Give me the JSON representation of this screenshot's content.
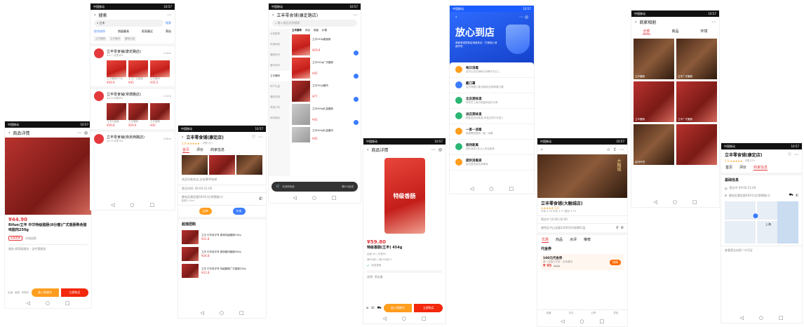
{
  "status": {
    "left": "中国移动",
    "right": "10:57"
  },
  "s1": {
    "title": "商品详情",
    "price": "¥44.90",
    "name": "Rifun/立丰 中华特级腊肠(8分瘦)广式香肠熟食腊味腊肉250g",
    "tag": "免费退换",
    "tag2": "闪电退款",
    "service": "服务 商家配服务 · 全件满意退",
    "btn_cart": "加入购物车",
    "btn_buy": "立即购买",
    "bt1": "店铺",
    "bt2": "客服",
    "bt3": "购物车"
  },
  "s2": {
    "title": "搜索",
    "search": "立丰",
    "search_btn": "搜索",
    "tabs": [
      "综合排序",
      "销量最高",
      "距离最近",
      "筛选"
    ],
    "chips": [
      "立丰腊肠",
      "立丰腊肉",
      "腊味礼盒"
    ],
    "shops": [
      {
        "name": "立丰零食铺(康定路店)",
        "meta": "★4.7 月售999",
        "dist": "1.5km",
        "items": [
          {
            "n": "立丰腊肠250g",
            "p": "¥29.9"
          },
          {
            "n": "立丰广式香肠",
            "p": "¥45"
          },
          {
            "n": "立丰腊肉",
            "p": "¥35.5"
          }
        ]
      },
      {
        "name": "立丰零食铺(常德路店)",
        "meta": "★4.8 月售800",
        "dist": "2.1km",
        "items": [
          {
            "n": "立丰礼盒装",
            "p": "¥59.8"
          },
          {
            "n": "立丰腊肠",
            "p": "¥29.9"
          },
          {
            "n": "立丰香肠",
            "p": "¥45"
          }
        ]
      },
      {
        "name": "立丰零食铺(南京西路店)",
        "meta": "★4.6 月售700",
        "dist": "2.8km",
        "items": []
      }
    ]
  },
  "s3": {
    "title": "立丰零食铺(康定店)",
    "rating": "5.0 ★★★★★",
    "sold": "月售1万+",
    "tabs": [
      "首页",
      "评价",
      "商家信息"
    ],
    "notice": "欢迎光临本店,全场满99包邮",
    "hours": "营业时间: 09:00-21:00",
    "addr": "静安区康定路583号(近常德路口)",
    "addr2": "距离1.5km",
    "btn1": "买单",
    "btn2": "外卖",
    "section": "超值团购",
    "deals": [
      {
        "n": "立丰 中华老字号 原味特级腊肠150g",
        "p": "¥21.8"
      },
      {
        "n": "立丰 中华老字号 原味腊肉腊肠950g",
        "p": "¥26.8"
      },
      {
        "n": "立丰 中华老字号 特级腊肠广式香肠250g",
        "p": "¥31.8"
      }
    ]
  },
  "s4": {
    "title": "立丰零食铺(康定路店)",
    "search_ph": "输入商品名称搜索",
    "cats": [
      "为您推荐",
      "热销商品",
      "腊肠系列",
      "腊肉系列",
      "立丰腊味",
      "特产礼盒",
      "腊味拼盘",
      "零食小吃",
      "休闲食品"
    ],
    "subtabs": [
      "立丰腊味",
      "综合",
      "销量",
      "价格"
    ],
    "items": [
      {
        "n": "立丰250g腊香肠",
        "p": "¥29.9"
      },
      {
        "n": "立丰250g广式腊肠",
        "p": "¥45"
      },
      {
        "n": "立丰250g腊肉",
        "p": "¥77"
      },
      {
        "n": "立丰400g礼盒腊肠",
        "p": "¥45"
      },
      {
        "n": "立丰400g礼盒腊肉",
        "p": "¥45"
      }
    ],
    "cart": "未选购商品",
    "cart_btn": "满¥20起送"
  },
  "s5": {
    "title": "商品详情",
    "price": "¥59.80",
    "name": "特级香肠(立丰) 454g",
    "ship": "运费 ¥0 | 月售99",
    "promo": "满99减5 | 满199减15",
    "tag": "免费退换",
    "spec": "选择: 净含量",
    "btn_cart": "加入购物车",
    "btn_buy": "立即购买",
    "pkg_text": "特级香肠"
  },
  "s6": {
    "heading": "放心到店",
    "sub": "商家承诺您到店消费安全 · 打造放心消费环境",
    "items": [
      {
        "t": "每日消毒",
        "d": "店内公共区域每日消毒3次以上",
        "c": "#ff9d1e"
      },
      {
        "t": "戴口罩",
        "d": "店员佩戴口罩,顾客进店需佩戴口罩",
        "c": "#3b7cff"
      },
      {
        "t": "全员测体温",
        "d": "所有员工每日测量体温并记录",
        "c": "#2bb673"
      },
      {
        "t": "进店测体温",
        "d": "顾客进店测体温,体温正常方可进入",
        "c": "#2bb673"
      },
      {
        "t": "一客一消毒",
        "d": "桌椅餐具做到一客一消毒",
        "c": "#ff9d1e"
      },
      {
        "t": "保持距离",
        "d": "排队保持1米以上安全距离",
        "c": "#2bb673"
      },
      {
        "t": "提供消毒液",
        "d": "店内提供免洗消毒液",
        "c": "#ff9d1e"
      }
    ]
  },
  "s7": {
    "shop": "立丰零食铺(大融城店)",
    "rating": "★★★★★ 5.0",
    "metrics": "口味 4.76  环境 4.77  服务 4.73",
    "hours": "营业中 10:00-20:00",
    "addr": "普陀区中山北路3300号环球港B1层",
    "label": "大融城",
    "tabs": [
      "优惠",
      "商品",
      "点评",
      "推荐"
    ],
    "section": "代金券",
    "coupon_t": "100元代金券",
    "coupon_d": "周一至周日可用 · 全场通用",
    "coupon_p": "¥ 95",
    "coupon_op": "¥100",
    "coupon_btn": "抢购",
    "bottom": [
      "收藏",
      "评论",
      "分享",
      "导航"
    ]
  },
  "s8": {
    "title": "商家相册",
    "tabs": [
      "全部",
      "商品",
      "环境"
    ],
    "cap1": "立丰腊肠",
    "cap2": "立丰广式腊肠",
    "cap3": "立丰腊肠",
    "cap4": "立丰广式腊肠",
    "cap5": "店内环境"
  },
  "s9": {
    "title": "立丰零食铺(康定店)",
    "rating": "5.0 ★★★★★",
    "sold": "月售1万+",
    "tabs": [
      "首页",
      "评价",
      "商家信息"
    ],
    "sec": "基础信息",
    "hours": "营业中 09:00-21:00",
    "addr": "静安区康定路583号(近常德路口)",
    "map_label": "上海",
    "license": "查看营业执照 / 许可证"
  }
}
